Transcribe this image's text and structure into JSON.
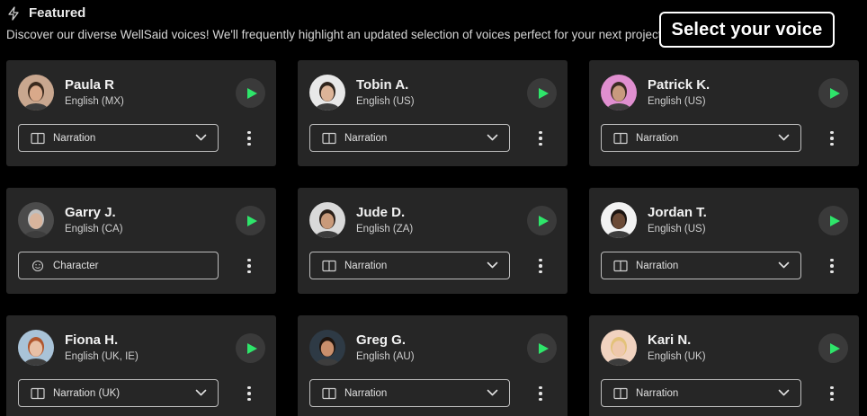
{
  "header": {
    "title": "Featured",
    "subtitle": "Discover our diverse WellSaid voices! We'll frequently highlight an updated selection of voices perfect for your next project.",
    "icon": "bolt-icon"
  },
  "badge": {
    "label": "Select your voice"
  },
  "colors": {
    "accent": "#2ee56a",
    "card": "#262626",
    "background": "#000000"
  },
  "voices": [
    {
      "name": "Paula R",
      "language": "English (MX)",
      "style": "Narration",
      "style_icon": "book-icon",
      "has_dropdown": true
    },
    {
      "name": "Tobin A.",
      "language": "English (US)",
      "style": "Narration",
      "style_icon": "book-icon",
      "has_dropdown": true
    },
    {
      "name": "Patrick K.",
      "language": "English (US)",
      "style": "Narration",
      "style_icon": "book-icon",
      "has_dropdown": true
    },
    {
      "name": "Garry J.",
      "language": "English (CA)",
      "style": "Character",
      "style_icon": "smiley-icon",
      "has_dropdown": false
    },
    {
      "name": "Jude D.",
      "language": "English (ZA)",
      "style": "Narration",
      "style_icon": "book-icon",
      "has_dropdown": true
    },
    {
      "name": "Jordan T.",
      "language": "English (US)",
      "style": "Narration",
      "style_icon": "book-icon",
      "has_dropdown": true
    },
    {
      "name": "Fiona H.",
      "language": "English (UK, IE)",
      "style": "Narration (UK)",
      "style_icon": "book-icon",
      "has_dropdown": true
    },
    {
      "name": "Greg G.",
      "language": "English (AU)",
      "style": "Narration",
      "style_icon": "book-icon",
      "has_dropdown": true
    },
    {
      "name": "Kari N.",
      "language": "English (UK)",
      "style": "Narration",
      "style_icon": "book-icon",
      "has_dropdown": true
    }
  ]
}
